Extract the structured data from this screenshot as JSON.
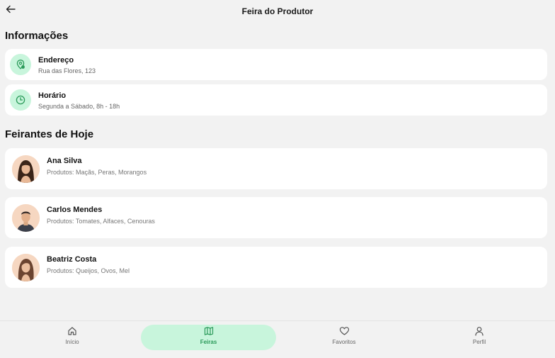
{
  "header": {
    "title": "Feira do Produtor",
    "back_icon": "arrow-left-icon"
  },
  "sections": {
    "info_title": "Informações",
    "vendors_title": "Feirantes de Hoje"
  },
  "info": {
    "address": {
      "label": "Endereço",
      "value": "Rua das Flores, 123",
      "icon": "map-pin-icon"
    },
    "hours": {
      "label": "Horário",
      "value": "Segunda a Sábado, 8h - 18h",
      "icon": "clock-icon"
    }
  },
  "vendors": [
    {
      "name": "Ana Silva",
      "products": "Produtos: Maçãs, Peras, Morangos"
    },
    {
      "name": "Carlos Mendes",
      "products": "Produtos: Tomates, Alfaces, Cenouras"
    },
    {
      "name": "Beatriz Costa",
      "products": "Produtos: Queijos, Ovos, Mel"
    }
  ],
  "nav": {
    "items": [
      {
        "label": "Início",
        "icon": "home-icon"
      },
      {
        "label": "Feiras",
        "icon": "map-icon",
        "active": true
      },
      {
        "label": "Favoritos",
        "icon": "heart-icon"
      },
      {
        "label": "Perfil",
        "icon": "user-icon"
      }
    ]
  },
  "colors": {
    "accent": "#2b9a5a",
    "accent_light": "#c8f5dc",
    "background": "#f2f2f2",
    "card": "#ffffff"
  }
}
